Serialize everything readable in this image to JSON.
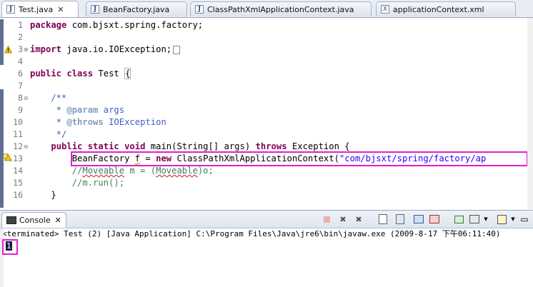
{
  "tabs": [
    {
      "label": "Test.java",
      "icon": "java-file-icon",
      "active": true,
      "closable": true
    },
    {
      "label": "BeanFactory.java",
      "icon": "java-file-icon",
      "active": false
    },
    {
      "label": "ClassPathXmlApplicationContext.java",
      "icon": "java-file-icon",
      "active": false
    },
    {
      "label": "applicationContext.xml",
      "icon": "xml-file-icon",
      "active": false
    }
  ],
  "editor": {
    "lines": [
      {
        "num": "1",
        "text": "package com.bjsxt.spring.factory;"
      },
      {
        "num": "2",
        "text": ""
      },
      {
        "num": "3",
        "text": "import java.io.IOException;"
      },
      {
        "num": "4",
        "text": ""
      },
      {
        "num": "6",
        "text": "public class Test {"
      },
      {
        "num": "7",
        "text": ""
      },
      {
        "num": "8",
        "text": "    /**"
      },
      {
        "num": "9",
        "text": "     * @param args"
      },
      {
        "num": "10",
        "text": "     * @throws IOException"
      },
      {
        "num": "11",
        "text": "     */"
      },
      {
        "num": "12",
        "text": "    public static void main(String[] args) throws Exception {"
      },
      {
        "num": "13",
        "text": "        BeanFactory f = new ClassPathXmlApplicationContext(\"com/bjsxt/spring/factory/ap"
      },
      {
        "num": "14",
        "text": "        //Moveable m = (Moveable)o;"
      },
      {
        "num": "15",
        "text": "        //m.run();"
      },
      {
        "num": "16",
        "text": "    }"
      }
    ]
  },
  "console": {
    "tab_label": "Console",
    "status": "<terminated> Test (2) [Java Application] C:\\Program Files\\Java\\jre6\\bin\\javaw.exe (2009-8-17 下午06:11:40)",
    "output": "1"
  },
  "colors": {
    "highlight": "#e020d0",
    "keyword": "#7f0055",
    "string": "#2a00ff",
    "comment": "#3f7f5f",
    "javadoc": "#3f5fbf"
  }
}
